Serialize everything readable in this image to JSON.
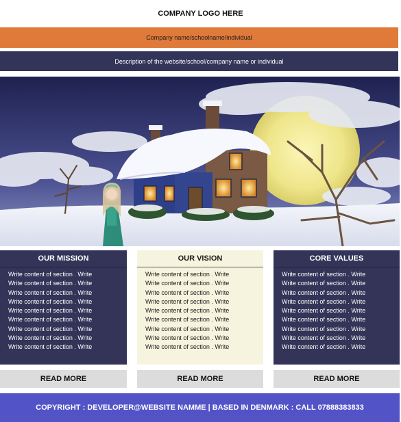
{
  "header": {
    "logo_text": "COMPANY LOGO HERE",
    "name_text": "Company name/schoolname/individual",
    "description_text": "Description of the website/school/company name or individual"
  },
  "hero": {
    "image": "winter-cottage-scene"
  },
  "sections": [
    {
      "title": "OUR MISSION",
      "lines": [
        "Write content of section . Write",
        "Write content of section . Write",
        "Write content of section . Write",
        "Write content of section . Write",
        "Write content of section . Write",
        "Write content of section . Write",
        "Write content of section . Write",
        "Write content of section . Write",
        "Write content of section . Write"
      ],
      "button": "READ MORE"
    },
    {
      "title": "OUR VISION",
      "lines": [
        "Write content of section . Write",
        "Write content of section . Write",
        "Write content of section . Write",
        "Write content of section . Write",
        "Write content of section . Write",
        "Write content of section . Write",
        "Write content of section . Write",
        "Write content of section . Write",
        "Write content of section . Write"
      ],
      "button": "READ MORE"
    },
    {
      "title": "CORE VALUES",
      "lines": [
        "Write content of section . Write",
        "Write content of section . Write",
        "Write content of section . Write",
        "Write content of section . Write",
        "Write content of section . Write",
        "Write content of section . Write",
        "Write content of section . Write",
        "Write content of section . Write",
        "Write content of section . Write"
      ],
      "button": "READ MORE"
    }
  ],
  "footer": {
    "text": "COPYRIGHT : DEVELOPER@WEBSITE NAMME | BASED IN DENMARK : CALL 07888383833"
  },
  "colors": {
    "orange_bar": "#e07a3a",
    "navy": "#333458",
    "cream": "#f6f4df",
    "button_gray": "#dcdcdc",
    "footer_blue": "#5353c8"
  }
}
